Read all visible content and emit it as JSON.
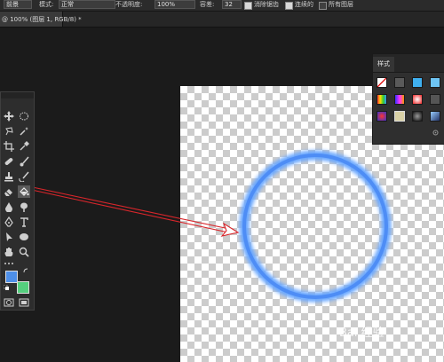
{
  "options_bar": {
    "mode_prefix": "前景",
    "mode_label": "模式:",
    "mode_value": "正常",
    "opacity_label": "不透明度:",
    "opacity_value": "100%",
    "tolerance_label": "容差:",
    "tolerance_value": "32",
    "antialias_label": "消除锯齿",
    "contiguous_label": "连续的",
    "all_layers_label": "所有图层"
  },
  "document_tab": {
    "title": "@ 100% (图层 1, RGB/8) *"
  },
  "styles_panel": {
    "tab_label": "样式"
  },
  "watermark": {
    "text": "Bai 经验",
    "sub": ""
  },
  "colors": {
    "foreground": "#4e8fe8",
    "background": "#55cf7e",
    "ring": "#5a9cff",
    "arrow": "#d8262b"
  }
}
